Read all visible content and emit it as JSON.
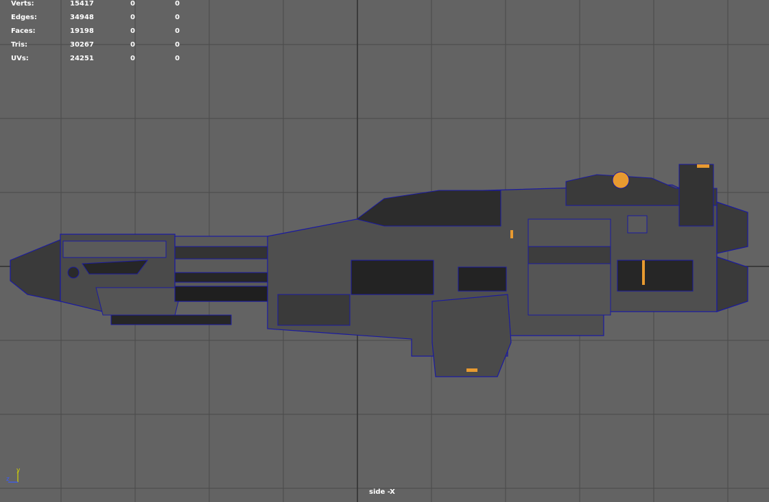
{
  "hud": {
    "rows": [
      {
        "label": "Verts:",
        "v1": "15417",
        "v2": "0",
        "v3": "0"
      },
      {
        "label": "Edges:",
        "v1": "34948",
        "v2": "0",
        "v3": "0"
      },
      {
        "label": "Faces:",
        "v1": "19198",
        "v2": "0",
        "v3": "0"
      },
      {
        "label": "Tris:",
        "v1": "30267",
        "v2": "0",
        "v3": "0"
      },
      {
        "label": "UVs:",
        "v1": "24251",
        "v2": "0",
        "v3": "0"
      }
    ]
  },
  "camera": {
    "label": "side -X"
  },
  "axis": {
    "y_label": "y",
    "z_label": "z",
    "y_color": "#d4d400",
    "z_color": "#3a5bff"
  },
  "colors": {
    "background": "#636363",
    "grid": "#4a4a4a",
    "grid_major": "#2e2e2e",
    "wire": "#1a1aa0",
    "hull_dark": "#262626",
    "hull_mid": "#5a5a5a",
    "accent": "#e89a30"
  }
}
